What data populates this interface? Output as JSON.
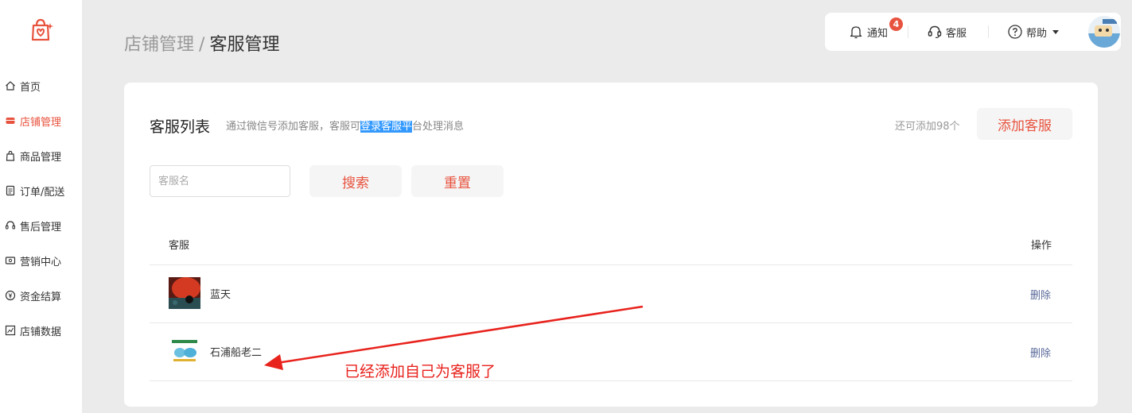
{
  "sidebar": {
    "logo_icon": "bag-heart-icon",
    "items": [
      {
        "label": "首页",
        "icon": "home-icon",
        "active": false
      },
      {
        "label": "店铺管理",
        "icon": "store-icon",
        "active": true
      },
      {
        "label": "商品管理",
        "icon": "bag-icon",
        "active": false
      },
      {
        "label": "订单/配送",
        "icon": "order-icon",
        "active": false
      },
      {
        "label": "售后管理",
        "icon": "headset-icon",
        "active": false
      },
      {
        "label": "营销中心",
        "icon": "ticket-icon",
        "active": false
      },
      {
        "label": "资金结算",
        "icon": "yen-icon",
        "active": false
      },
      {
        "label": "店铺数据",
        "icon": "chart-icon",
        "active": false
      }
    ]
  },
  "breadcrumb": {
    "parent": "店铺管理",
    "separator": "/",
    "current": "客服管理"
  },
  "topbar": {
    "notification_label": "通知",
    "notification_count": "4",
    "service_label": "客服",
    "help_label": "帮助"
  },
  "card": {
    "title": "客服列表",
    "desc_before": "通过微信号添加客服，客服可",
    "desc_highlight": "登录客服平",
    "desc_after": "台处理消息",
    "remain_text": "还可添加98个",
    "add_button": "添加客服",
    "search_placeholder": "客服名",
    "search_button": "搜索",
    "reset_button": "重置",
    "table": {
      "columns": [
        "客服",
        "操作"
      ],
      "rows": [
        {
          "name": "蓝天",
          "action": "删除"
        },
        {
          "name": "石浦船老二",
          "action": "删除"
        }
      ]
    }
  },
  "annotation": {
    "text": "已经添加自己为客服了"
  },
  "colors": {
    "accent": "#e8533f",
    "annotation": "#e8221c",
    "link": "#5a6a9a",
    "highlight": "#3399ff"
  }
}
